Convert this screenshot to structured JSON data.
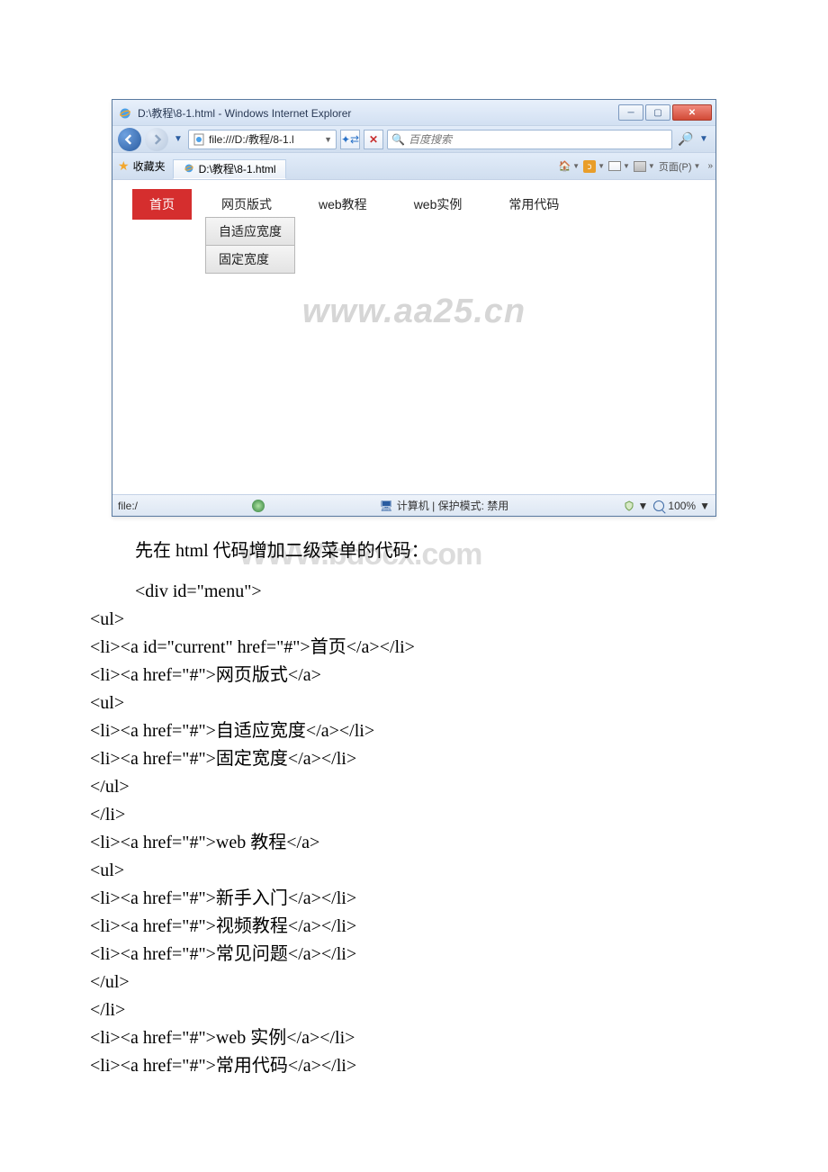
{
  "browser": {
    "window_title": "D:\\教程\\8-1.html - Windows Internet Explorer",
    "address": "file:///D:/教程/8-1.l",
    "search_placeholder": "百度搜索",
    "favorites_label": "收藏夹",
    "tab_title": "D:\\教程\\8-1.html",
    "page_menu_label": "页面(P)",
    "status_left": "file:/",
    "status_mode": "计算机 | 保护模式: 禁用",
    "zoom": "100%"
  },
  "nav": {
    "items": [
      "首页",
      "网页版式",
      "web教程",
      "web实例",
      "常用代码"
    ],
    "submenu2": [
      "自适应宽度",
      "固定宽度"
    ]
  },
  "watermarks": {
    "aa25": "www.aa25.cn",
    "bd": "WWW.bdocx.com"
  },
  "para1": "先在 html 代码增加二级菜单的代码：",
  "code": {
    "l0": "<div id=\"menu\">",
    "l1": "<ul>",
    "l2": "<li><a id=\"current\" href=\"#\">首页</a></li>",
    "l3": "<li><a href=\"#\">网页版式</a>",
    "l4": "<ul>",
    "l5": "<li><a href=\"#\">自适应宽度</a></li>",
    "l6": "<li><a href=\"#\">固定宽度</a></li>",
    "l7": "</ul>",
    "l8": "</li>",
    "l9": "<li><a href=\"#\">web 教程</a>",
    "l10": "<ul>",
    "l11": "<li><a href=\"#\">新手入门</a></li>",
    "l12": "<li><a href=\"#\">视频教程</a></li>",
    "l13": "<li><a href=\"#\">常见问题</a></li>",
    "l14": "</ul>",
    "l15": "</li>",
    "l16": "<li><a href=\"#\">web 实例</a></li>",
    "l17": "<li><a href=\"#\">常用代码</a></li>"
  }
}
